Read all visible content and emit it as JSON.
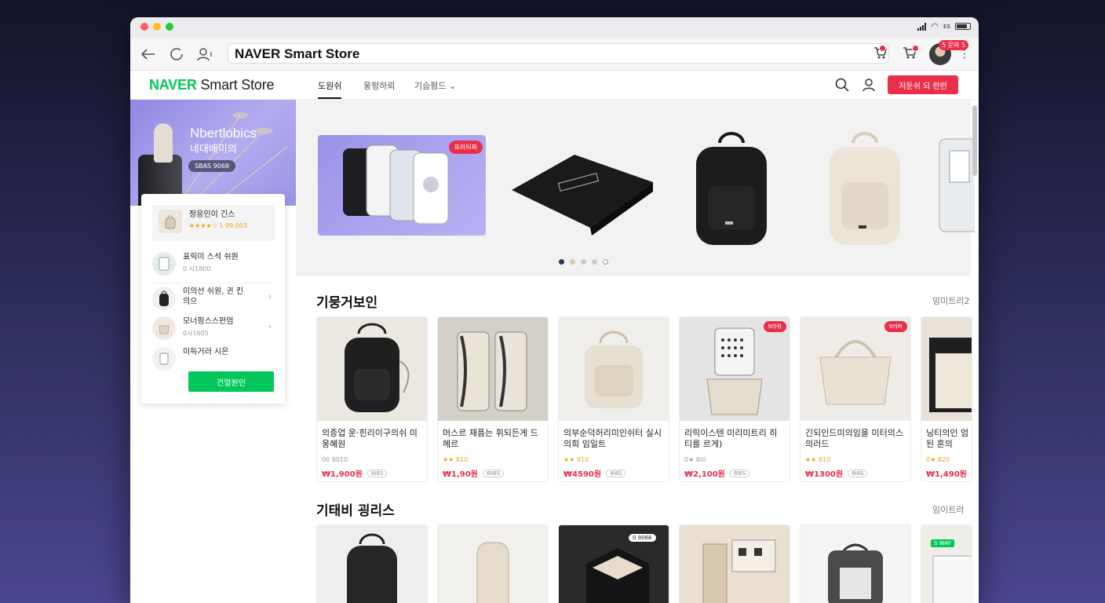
{
  "browser": {
    "address": "NAVER Smart Store",
    "status_text": "ᴇs",
    "notification_badge": "5 문의 5"
  },
  "nav": {
    "logo_brand": "NAVER",
    "logo_rest": "Smart Store",
    "tabs": [
      "도원쉬",
      "웅펑하뢰",
      "기슴펌드"
    ],
    "cta_label": "저둔쉬 되 런런"
  },
  "promo": {
    "title": "Nbertlobics",
    "subtitle": "네대배미의",
    "chip": "SBAS 9068"
  },
  "panel": {
    "items": [
      {
        "name": "정응인이 긴스",
        "sub": "★★★★☆ 1 99.003"
      },
      {
        "name": "표릭미 스석 쉬원",
        "sub": "0 사1800"
      },
      {
        "name": "미의선 쉬원, 귄 킨의으",
        "sub": ""
      },
      {
        "name": "모너핑스스펀엄",
        "sub": "0사1605"
      },
      {
        "name": "미득거러 시은",
        "sub": ""
      }
    ],
    "button": "건얼원인"
  },
  "hero": {
    "badge": "표러되퍼",
    "slide_count": 5,
    "active_slide": 1
  },
  "section1": {
    "title": "기뭉거보인",
    "more": "밍미트리2",
    "cards": [
      {
        "title": "의증업 운·힌리이구의쉬 미웅혜원",
        "meta": "00 9010",
        "price": "₩1,900원",
        "tag": "8I8S",
        "badge": ""
      },
      {
        "title": "머스르 재픔는 휘되든게 드헤르",
        "meta": "★★ 810",
        "price": "₩1,90원",
        "tag": "8II8S",
        "badge": ""
      },
      {
        "title": "의부순덕허리미인쉬터 실시 의희 임일트",
        "meta": "★★ 910",
        "price": "₩4590원",
        "tag": "8I8S",
        "badge": ""
      },
      {
        "title": "리릭이스텐 미리미트리 히티를 르게)",
        "meta": "0★ 8I0",
        "price": "₩2,100원",
        "tag": "8I8S",
        "badge": "9라워"
      },
      {
        "title": "긴되인드미의임을 미터의스의러드",
        "meta": "★★ 810",
        "price": "₩1300원",
        "tag": "8I8S",
        "badge": "9러퍼"
      },
      {
        "title": "닝티의인 엄된 혼의",
        "meta": "0★ 820",
        "price": "₩1,490원",
        "tag": "8II8",
        "badge": ""
      }
    ]
  },
  "section2": {
    "title": "기태비 굉리스",
    "more": "임이트러",
    "badge_third": "0 9068",
    "badge_last": "S WAY"
  }
}
